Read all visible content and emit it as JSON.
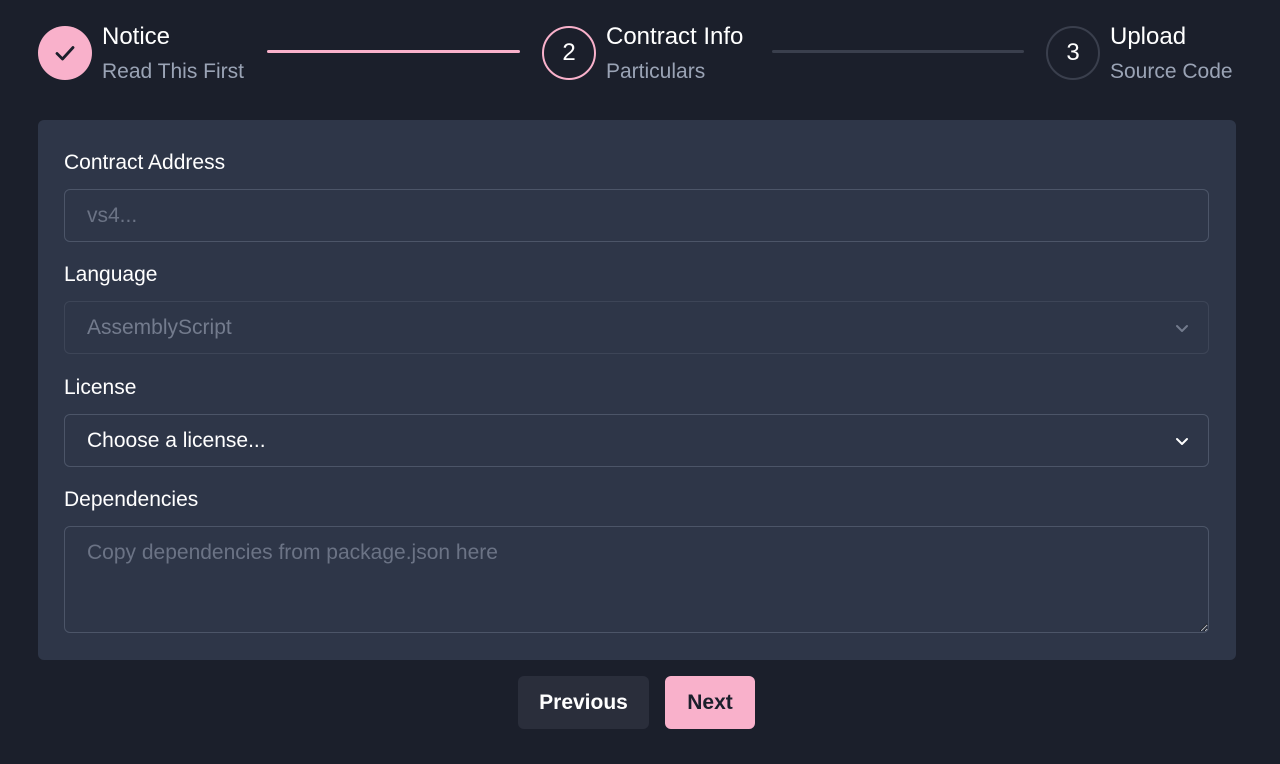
{
  "steps": [
    {
      "title": "Notice",
      "subtitle": "Read This First",
      "state": "done",
      "icon": "check-icon"
    },
    {
      "number": "2",
      "title": "Contract Info",
      "subtitle": "Particulars",
      "state": "active"
    },
    {
      "number": "3",
      "title": "Upload",
      "subtitle": "Source Code",
      "state": "todo"
    }
  ],
  "form": {
    "contract_address": {
      "label": "Contract Address",
      "placeholder": "vs4...",
      "value": ""
    },
    "language": {
      "label": "Language",
      "selected": "AssemblyScript",
      "disabled": true
    },
    "license": {
      "label": "License",
      "selected": "Choose a license..."
    },
    "dependencies": {
      "label": "Dependencies",
      "placeholder": "Copy dependencies from package.json here",
      "value": ""
    }
  },
  "buttons": {
    "previous": "Previous",
    "next": "Next"
  },
  "colors": {
    "accent": "#f9b1cb",
    "background": "#1b1f2b",
    "card": "#2e3648"
  }
}
